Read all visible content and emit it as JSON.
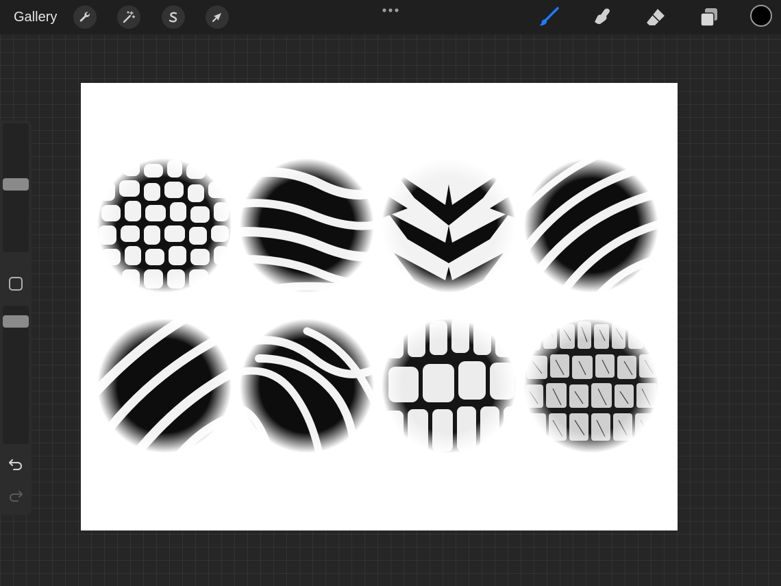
{
  "topbar": {
    "gallery_label": "Gallery",
    "tools_left": [
      {
        "name": "actions",
        "icon": "wrench-icon"
      },
      {
        "name": "adjustments",
        "icon": "magic-wand-icon"
      },
      {
        "name": "selection",
        "icon": "selection-s-icon"
      },
      {
        "name": "transform",
        "icon": "arrow-cursor-icon"
      }
    ],
    "more_icon": "ellipsis-icon",
    "tools_right": [
      {
        "name": "paint",
        "icon": "brush-icon",
        "active": true
      },
      {
        "name": "smudge",
        "icon": "smudge-finger-icon",
        "active": false
      },
      {
        "name": "erase",
        "icon": "eraser-icon",
        "active": false
      },
      {
        "name": "layers",
        "icon": "layers-icon",
        "active": false
      }
    ],
    "current_color": "#000000"
  },
  "sidebar": {
    "brush_size_level": 0.5,
    "opacity_level": 0.92,
    "modify_icon": "square-icon",
    "undo_icon": "undo-arrow-icon",
    "redo_icon": "redo-arrow-icon"
  },
  "canvas": {
    "background": "#ffffff",
    "stamps": [
      {
        "name": "giraffe-pattern",
        "row": 1,
        "col": 1
      },
      {
        "name": "zebra-stripes-diagonal",
        "row": 1,
        "col": 2
      },
      {
        "name": "tiger-chevron",
        "row": 1,
        "col": 3
      },
      {
        "name": "zebra-stripes-curved",
        "row": 1,
        "col": 4
      },
      {
        "name": "zebra-stripes-bold",
        "row": 2,
        "col": 1
      },
      {
        "name": "zebra-stripes-wavy",
        "row": 2,
        "col": 2
      },
      {
        "name": "crocodile-scales",
        "row": 2,
        "col": 3
      },
      {
        "name": "crocodile-skin-cracked",
        "row": 2,
        "col": 4
      }
    ]
  },
  "colors": {
    "accent": "#1e7bff",
    "toolbar_bg": "#1f1f1f",
    "workspace_bg": "#262626"
  }
}
